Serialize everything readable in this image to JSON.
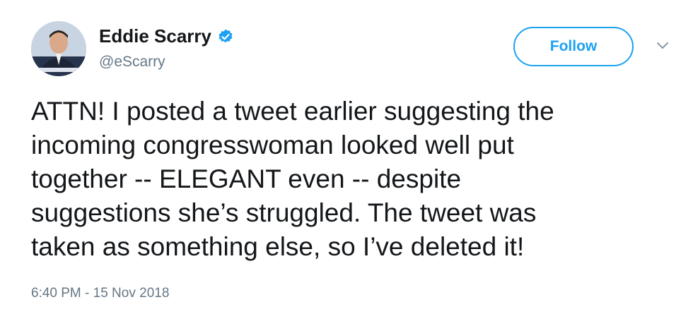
{
  "author": {
    "name": "Eddie Scarry",
    "handle": "@eScarry",
    "verified": true,
    "avatar_icon": "user-avatar"
  },
  "follow_button": {
    "label": "Follow"
  },
  "menu": {
    "icon": "chevron-down-icon"
  },
  "tweet": {
    "text": "ATTN! I posted a tweet earlier suggesting the\nincoming congresswoman looked well put\ntogether -- ELEGANT even -- despite\nsuggestions she’s struggled. The tweet was\ntaken as something else, so I’ve deleted it!",
    "timestamp": "6:40 PM - 15 Nov 2018"
  },
  "colors": {
    "accent": "#1da1f2",
    "text": "#14171a",
    "secondary": "#657786"
  }
}
